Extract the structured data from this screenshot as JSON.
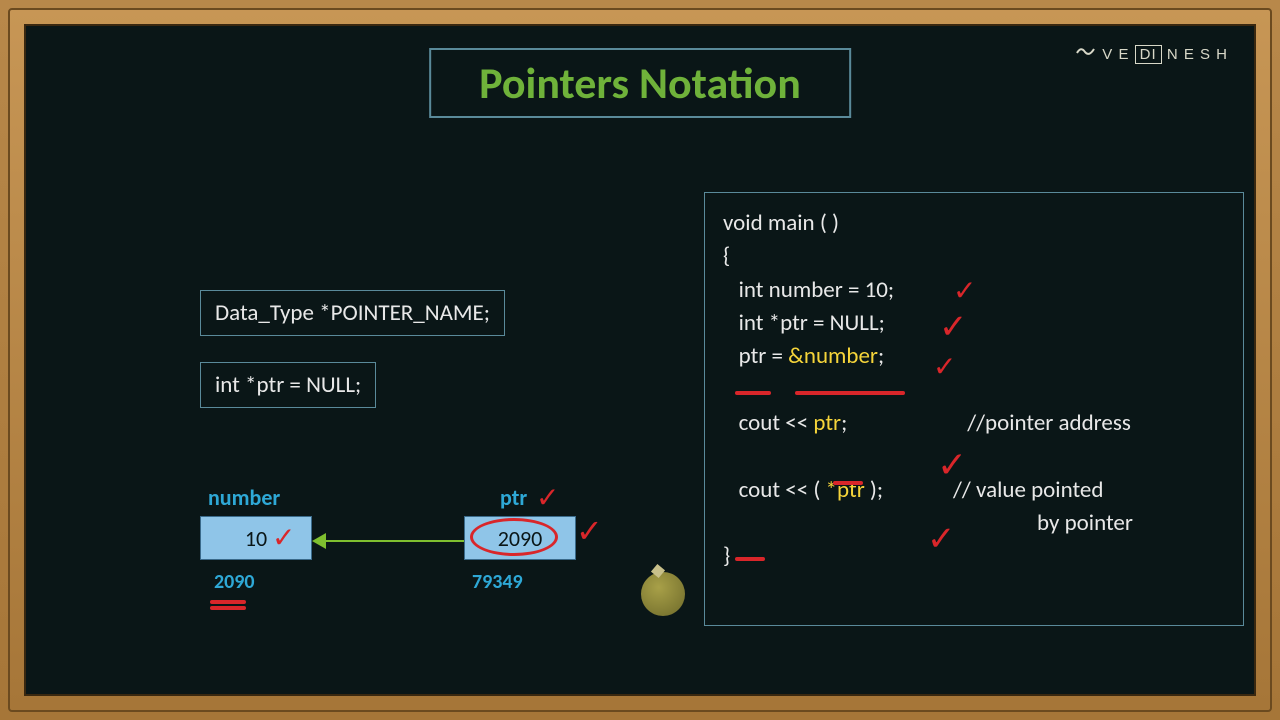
{
  "title": "Pointers  Notation",
  "watermark": {
    "pre": "V E",
    "boxed": "DI",
    "post": "N E S H"
  },
  "syntax": {
    "line1": "Data_Type *POINTER_NAME;",
    "line2": "int  *ptr = NULL;"
  },
  "memory": {
    "number": {
      "label": "number",
      "value": "10",
      "address": "2090"
    },
    "ptr": {
      "label": "ptr",
      "value": "2090",
      "address": "79349"
    }
  },
  "code": {
    "l1": "void main ( )",
    "l2": "{",
    "l3a": "   int number = 10;",
    "l4a": "   int *ptr = NULL;",
    "l5a": "   ptr = ",
    "l5b": "&number",
    "l5c": ";",
    "l6a": "   cout << ",
    "l6b": "ptr",
    "l6c": ";",
    "c6": "//pointer address",
    "l7a": "   cout << ( ",
    "l7b": "*ptr",
    "l7c": " );",
    "c7a": "// value pointed",
    "c7b": "     by pointer",
    "l8": "}"
  }
}
